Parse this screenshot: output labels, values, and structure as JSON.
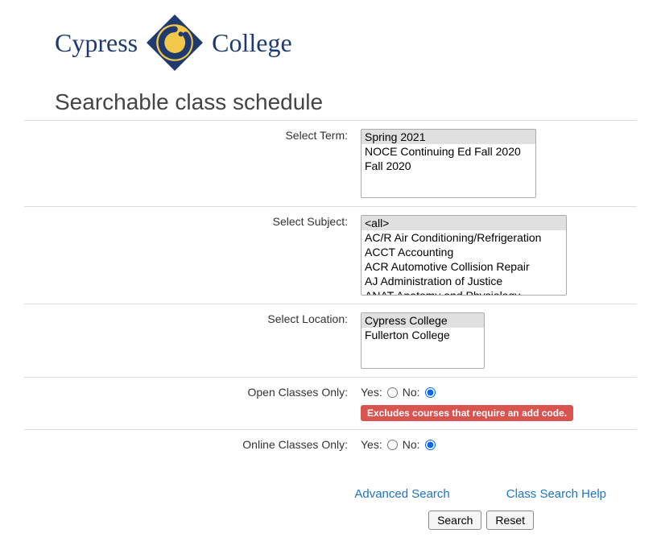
{
  "logo": {
    "left": "Cypress",
    "right": "College"
  },
  "title": "Searchable class schedule",
  "form": {
    "term": {
      "label": "Select Term:",
      "options": [
        "Spring 2021",
        "NOCE Continuing Ed Fall 2020",
        "Fall 2020"
      ],
      "selected": "Spring 2021"
    },
    "subject": {
      "label": "Select Subject:",
      "options": [
        "<all>",
        "AC/R Air Conditioning/Refrigeration",
        "ACCT Accounting",
        "ACR Automotive Collision Repair",
        "AJ Administration of Justice",
        "ANAT Anatomy and Physiology"
      ],
      "selected": "<all>"
    },
    "location": {
      "label": "Select Location:",
      "options": [
        "Cypress College",
        "Fullerton College"
      ],
      "selected": "Cypress College"
    },
    "open_only": {
      "label": "Open Classes Only:",
      "yes": "Yes:",
      "no": "No:",
      "value": "no",
      "note": "Excludes courses that require an add code."
    },
    "online_only": {
      "label": "Online Classes Only:",
      "yes": "Yes:",
      "no": "No:",
      "value": "no"
    }
  },
  "links": {
    "advanced": "Advanced Search",
    "help": "Class Search Help"
  },
  "buttons": {
    "search": "Search",
    "reset": "Reset"
  }
}
